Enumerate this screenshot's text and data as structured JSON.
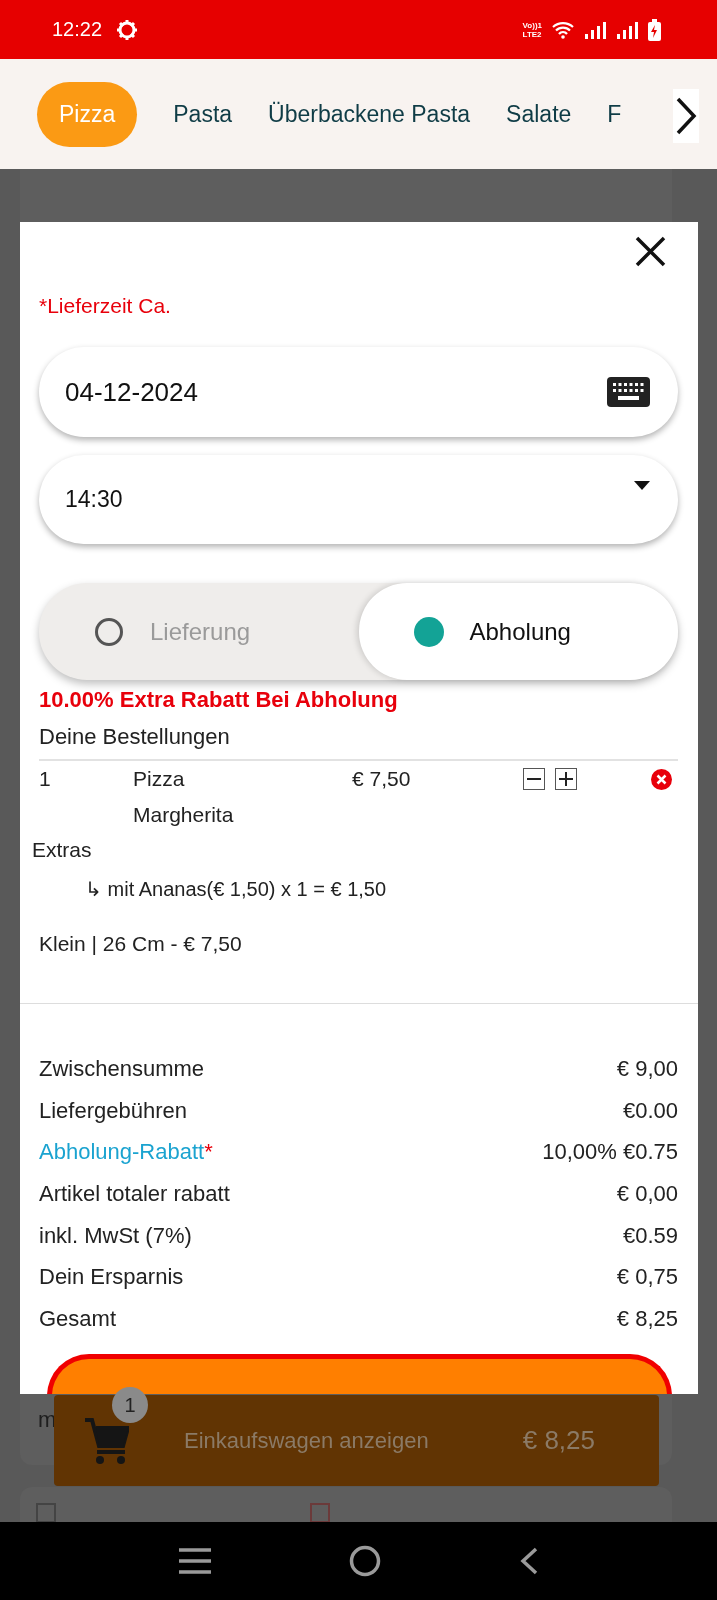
{
  "status_bar": {
    "time": "12:22",
    "network_label": [
      "Vo))1",
      "LTE2"
    ]
  },
  "tabs": [
    {
      "label": "Pizza",
      "selected": true
    },
    {
      "label": "Pasta",
      "selected": false
    },
    {
      "label": "Überbackene Pasta",
      "selected": false
    },
    {
      "label": "Salate",
      "selected": false
    },
    {
      "label": "F",
      "selected": false
    }
  ],
  "background": {
    "card_text": "m"
  },
  "dialog": {
    "delivery_time_label": "*Lieferzeit Ca.",
    "date_field": {
      "value": "04-12-2024"
    },
    "time_select": {
      "value": "14:30"
    },
    "order_type": [
      {
        "label": "Lieferung",
        "selected": false
      },
      {
        "label": "Abholung",
        "selected": true
      }
    ],
    "promo": "10.00% Extra Rabatt Bei Abholung",
    "orders_heading": "Deine Bestellungen",
    "orders": [
      {
        "quantity": "1",
        "name": "Pizza Margherita",
        "price": "€ 7,50",
        "extras_label": "Extras",
        "extras": [
          "↳ mit Ananas(€ 1,50) x 1 = € 1,50"
        ],
        "size": "Klein | 26 Cm - € 7,50"
      }
    ],
    "totals": [
      {
        "kind": "plain",
        "label": "Zwischensumme",
        "value": "€ 9,00"
      },
      {
        "kind": "plain",
        "label": "Liefergebühren",
        "value": "€0.00"
      },
      {
        "kind": "discount",
        "label": "Abholung-Rabatt",
        "suffix": "*",
        "value": "10,00% €0.75"
      },
      {
        "kind": "plain",
        "label": "Artikel totaler rabatt",
        "value": "€ 0,00"
      },
      {
        "kind": "plain",
        "label": "inkl. MwSt (7%)",
        "value": "€0.59"
      },
      {
        "kind": "plain",
        "label": "Dein Ersparnis",
        "value": "€ 0,75"
      },
      {
        "kind": "plain",
        "label": "Gesamt",
        "value": "€ 8,25"
      }
    ]
  },
  "cart_bar": {
    "count": "1",
    "label": "Einkaufswagen anzeigen",
    "total": "€ 8,25"
  }
}
